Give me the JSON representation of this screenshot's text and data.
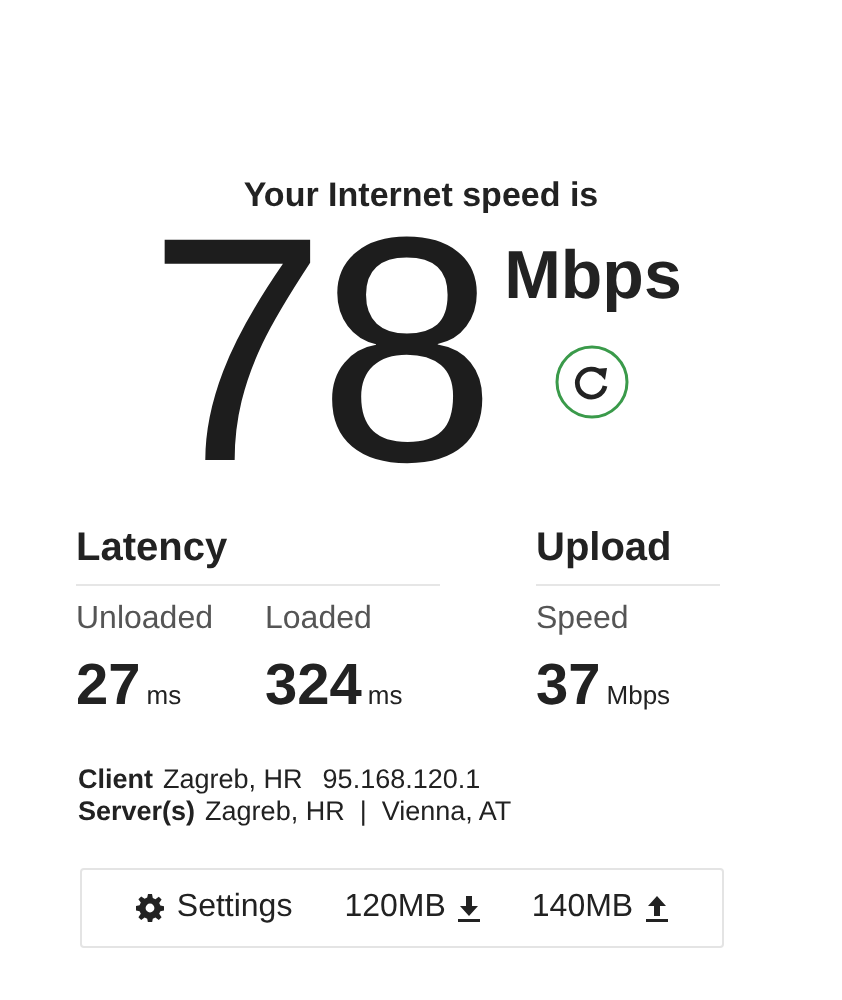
{
  "header": {
    "title": "Your Internet speed is",
    "speed": "78",
    "unit": "Mbps"
  },
  "groups": [
    {
      "title": "Latency",
      "metrics": [
        {
          "label": "Unloaded",
          "value": "27",
          "unit": "ms"
        },
        {
          "label": "Loaded",
          "value": "324",
          "unit": "ms"
        }
      ]
    },
    {
      "title": "Upload",
      "metrics": [
        {
          "label": "Speed",
          "value": "37",
          "unit": "Mbps"
        }
      ]
    }
  ],
  "info": [
    {
      "label": "Client",
      "values": [
        "Zagreb, HR",
        "95.168.120.1"
      ]
    },
    {
      "label": "Server(s)",
      "values": [
        "Zagreb, HR  |  Vienna, AT"
      ]
    }
  ],
  "settings_bar": {
    "settings": "Settings",
    "download": "120MB",
    "upload": "140MB"
  }
}
